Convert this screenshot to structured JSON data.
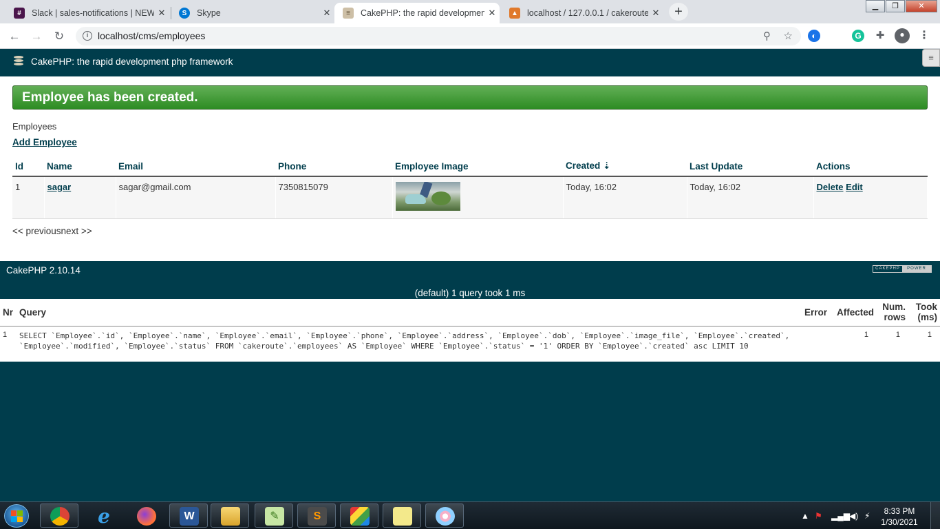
{
  "browser": {
    "tabs": [
      {
        "title": "Slack | sales-notifications | NEWJ",
        "icon": "slack-icon",
        "color": "#4a154b"
      },
      {
        "title": "Skype",
        "icon": "skype-icon",
        "color": "#0078d4"
      },
      {
        "title": "CakePHP: the rapid development",
        "icon": "cakephp-icon",
        "color": "#7b6a55"
      },
      {
        "title": "localhost / 127.0.0.1 / cakeroute",
        "icon": "phpmyadmin-icon",
        "color": "#e0792b"
      }
    ],
    "active_tab": 2,
    "url": "localhost/cms/employees"
  },
  "page": {
    "header_title": "CakePHP: the rapid development php framework",
    "flash": "Employee has been created.",
    "breadcrumb": "Employees",
    "add_link": "Add Employee",
    "columns": [
      "Id",
      "Name",
      "Email",
      "Phone",
      "Employee Image",
      "Created ⇣",
      "Last Update",
      "Actions"
    ],
    "rows": [
      {
        "id": "1",
        "name": "sagar",
        "email": "sagar@gmail.com",
        "phone": "7350815079",
        "created": "Today, 16:02",
        "updated": "Today, 16:02",
        "delete": "Delete",
        "edit": "Edit"
      }
    ],
    "pager_prev": "<< previous",
    "pager_next": "next >>"
  },
  "footer": {
    "version": "CakePHP 2.10.14",
    "power_left": "CAKEPHP",
    "power_right": "POWER",
    "query_caption": "(default) 1 query took 1 ms"
  },
  "sql": {
    "headers": {
      "nr": "Nr",
      "query": "Query",
      "error": "Error",
      "affected": "Affected",
      "num_rows": "Num. rows",
      "took": "Took (ms)"
    },
    "rows": [
      {
        "nr": "1",
        "query": "SELECT `Employee`.`id`, `Employee`.`name`, `Employee`.`email`, `Employee`.`phone`, `Employee`.`address`, `Employee`.`dob`, `Employee`.`image_file`, `Employee`.`created`, `Employee`.`modified`, `Employee`.`status` FROM `cakeroute`.`employees` AS `Employee` WHERE `Employee`.`status` = '1' ORDER BY `Employee`.`created` asc LIMIT 10",
        "error": "",
        "affected": "1",
        "num_rows": "1",
        "took": "1"
      }
    ]
  },
  "taskbar": {
    "time": "8:33 PM",
    "date": "1/30/2021"
  }
}
